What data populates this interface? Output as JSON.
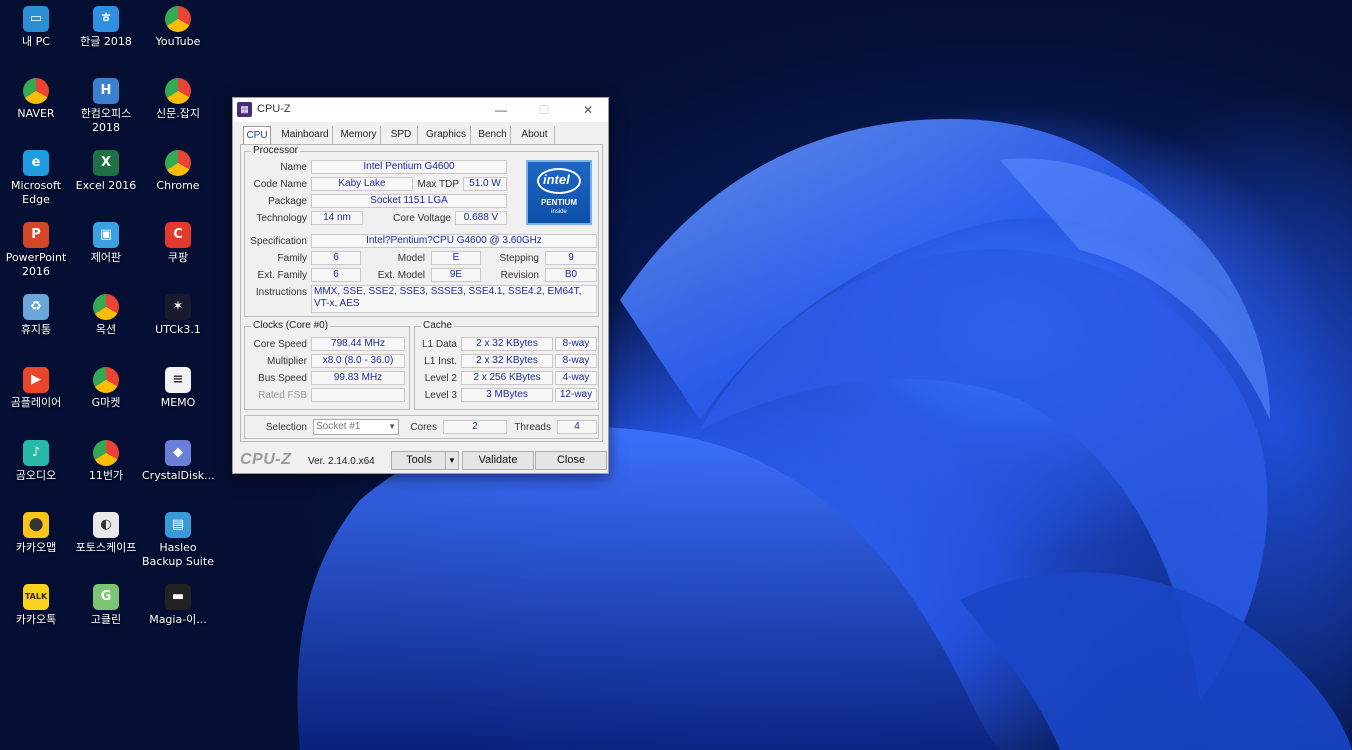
{
  "desktop": {
    "icons": [
      {
        "label": "내 PC",
        "icon": "computer-icon",
        "color": "#2b8fd6",
        "glyph": "▭"
      },
      {
        "label": "한글 2018",
        "icon": "hangul-icon",
        "color": "#2f8fe0",
        "glyph": "ㅎ"
      },
      {
        "label": "YouTube",
        "icon": "chrome-icon",
        "color": "#ffffff",
        "glyph": "●"
      },
      {
        "label": "NAVER",
        "icon": "chrome-icon",
        "color": "#ffffff",
        "glyph": "●"
      },
      {
        "label": "한컴오피스 2018",
        "icon": "hancom-icon",
        "color": "#3a7fd0",
        "glyph": "H"
      },
      {
        "label": "신문.잡지",
        "icon": "chrome-icon",
        "color": "#ffffff",
        "glyph": "●"
      },
      {
        "label": "Microsoft Edge",
        "icon": "edge-icon",
        "color": "#1f9be0",
        "glyph": "e"
      },
      {
        "label": "Excel 2016",
        "icon": "excel-icon",
        "color": "#1e7145",
        "glyph": "X"
      },
      {
        "label": "Chrome",
        "icon": "chrome-icon",
        "color": "#ffffff",
        "glyph": "●"
      },
      {
        "label": "PowerPoint 2016",
        "icon": "powerpoint-icon",
        "color": "#d24726",
        "glyph": "P"
      },
      {
        "label": "제어판",
        "icon": "control-panel-icon",
        "color": "#3aa0e0",
        "glyph": "▣"
      },
      {
        "label": "쿠팡",
        "icon": "coupang-icon",
        "color": "#e03a2f",
        "glyph": "C"
      },
      {
        "label": "휴지통",
        "icon": "recycle-bin-icon",
        "color": "#6aa6d8",
        "glyph": "♻"
      },
      {
        "label": "옥션",
        "icon": "chrome-icon",
        "color": "#ffffff",
        "glyph": "●"
      },
      {
        "label": "UTCk3.1",
        "icon": "utck-icon",
        "color": "#1a1a2e",
        "glyph": "✶"
      },
      {
        "label": "곰플레이어",
        "icon": "gom-player-icon",
        "color": "#e8452c",
        "glyph": "▶"
      },
      {
        "label": "G마켓",
        "icon": "chrome-icon",
        "color": "#ffffff",
        "glyph": "●"
      },
      {
        "label": "MEMO",
        "icon": "memo-icon",
        "color": "#f2f2f2",
        "glyph": "≡"
      },
      {
        "label": "곰오디오",
        "icon": "gom-audio-icon",
        "color": "#27b8a8",
        "glyph": "♪"
      },
      {
        "label": "11번가",
        "icon": "chrome-icon",
        "color": "#ffffff",
        "glyph": "●"
      },
      {
        "label": "CrystalDisk...",
        "icon": "crystaldisk-icon",
        "color": "#6a7fd8",
        "glyph": "◆"
      },
      {
        "label": "카카오맵",
        "icon": "kakao-map-icon",
        "color": "#f5c518",
        "glyph": "⬤"
      },
      {
        "label": "포토스케이프",
        "icon": "photoscape-icon",
        "color": "#e8e8e8",
        "glyph": "◐"
      },
      {
        "label": "Hasleo Backup Suite",
        "icon": "hasleo-icon",
        "color": "#3a9ad8",
        "glyph": "▤"
      },
      {
        "label": "카카오톡",
        "icon": "kakaotalk-icon",
        "color": "#f7d31e",
        "glyph": "TALK"
      },
      {
        "label": "고클린",
        "icon": "goclean-icon",
        "color": "#7cc576",
        "glyph": "G"
      },
      {
        "label": "Magia-이...",
        "icon": "magia-icon",
        "color": "#222222",
        "glyph": "▬"
      }
    ]
  },
  "window": {
    "title": "CPU-Z",
    "minimize": "—",
    "maximize": "☐",
    "close": "✕",
    "tabs": [
      "CPU",
      "Mainboard",
      "Memory",
      "SPD",
      "Graphics",
      "Bench",
      "About"
    ],
    "active_tab": "CPU"
  },
  "processor": {
    "group_title": "Processor",
    "name_label": "Name",
    "name": "Intel Pentium G4600",
    "codename_label": "Code Name",
    "codename": "Kaby Lake",
    "maxtdp_label": "Max TDP",
    "maxtdp": "51.0 W",
    "package_label": "Package",
    "package": "Socket 1151 LGA",
    "technology_label": "Technology",
    "technology": "14 nm",
    "corevoltage_label": "Core Voltage",
    "corevoltage": "0.688 V",
    "spec_label": "Specification",
    "spec": "Intel?Pentium?CPU G4600 @ 3.60GHz",
    "family_label": "Family",
    "family": "6",
    "model_label": "Model",
    "model": "E",
    "stepping_label": "Stepping",
    "stepping": "9",
    "extfamily_label": "Ext. Family",
    "extfamily": "6",
    "extmodel_label": "Ext. Model",
    "extmodel": "9E",
    "revision_label": "Revision",
    "revision": "B0",
    "instructions_label": "Instructions",
    "instructions": "MMX, SSE, SSE2, SSE3, SSSE3, SSE4.1, SSE4.2, EM64T, VT-x, AES",
    "badge": {
      "brand": "intel",
      "line": "PENTIUM",
      "sub": "inside"
    }
  },
  "clocks": {
    "group_title": "Clocks (Core #0)",
    "corespeed_label": "Core Speed",
    "corespeed": "798.44 MHz",
    "multiplier_label": "Multiplier",
    "multiplier": "x8.0 (8.0 - 36.0)",
    "busspeed_label": "Bus Speed",
    "busspeed": "99.83 MHz",
    "ratedfsb_label": "Rated FSB",
    "ratedfsb": ""
  },
  "cache": {
    "group_title": "Cache",
    "l1data_label": "L1 Data",
    "l1data": "2 x 32 KBytes",
    "l1data_way": "8-way",
    "l1inst_label": "L1 Inst.",
    "l1inst": "2 x 32 KBytes",
    "l1inst_way": "8-way",
    "l2_label": "Level 2",
    "l2": "2 x 256 KBytes",
    "l2_way": "4-way",
    "l3_label": "Level 3",
    "l3": "3 MBytes",
    "l3_way": "12-way"
  },
  "selection": {
    "label": "Selection",
    "value": "Socket #1",
    "cores_label": "Cores",
    "cores": "2",
    "threads_label": "Threads",
    "threads": "4"
  },
  "footer": {
    "brand": "CPU-Z",
    "version": "Ver. 2.14.0.x64",
    "tools": "Tools",
    "validate": "Validate",
    "close": "Close"
  }
}
